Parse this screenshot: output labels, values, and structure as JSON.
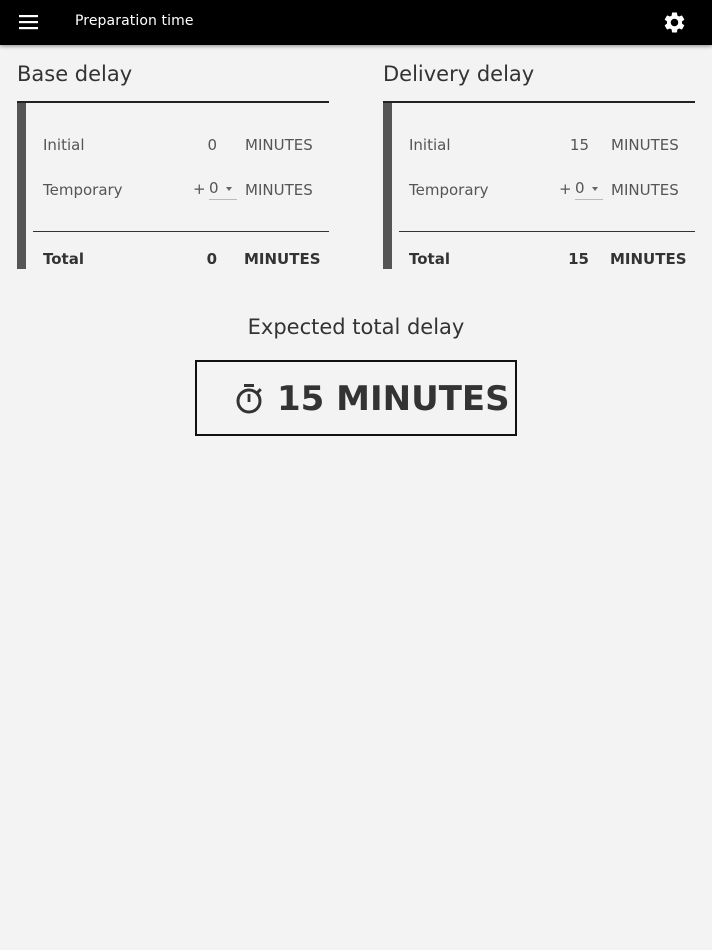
{
  "header": {
    "title": "Preparation time",
    "menu_icon": "hamburger-menu-icon",
    "settings_icon": "gear-icon"
  },
  "base_delay": {
    "title": "Base delay",
    "initial": {
      "label": "Initial",
      "value": "0",
      "unit": "MINUTES"
    },
    "temporary": {
      "label": "Temporary",
      "prefix": "+",
      "selected": "0",
      "unit": "MINUTES"
    },
    "total": {
      "label": "Total",
      "value": "0",
      "unit": "MINUTES"
    }
  },
  "delivery_delay": {
    "title": "Delivery delay",
    "initial": {
      "label": "Initial",
      "value": "15",
      "unit": "MINUTES"
    },
    "temporary": {
      "label": "Temporary",
      "prefix": "+",
      "selected": "0",
      "unit": "MINUTES"
    },
    "total": {
      "label": "Total",
      "value": "15",
      "unit": "MINUTES"
    }
  },
  "expected": {
    "title": "Expected total delay",
    "value": "15 MINUTES",
    "icon": "stopwatch-icon"
  },
  "colors": {
    "header_bg": "#000000",
    "page_bg": "#f3f3f3",
    "panel_accent": "#555555",
    "text": "#333333"
  }
}
